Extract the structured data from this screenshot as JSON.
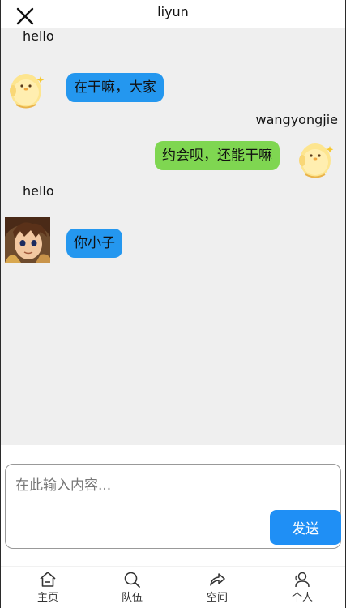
{
  "header": {
    "title": "liyun",
    "close_icon": "close-icon"
  },
  "messages": [
    {
      "sender": "hello",
      "text": "在干嘛，大家",
      "side": "left",
      "avatar": "chick-avatar",
      "bubble_color": "#2497ef"
    },
    {
      "sender": "wangyongjie",
      "text": "约会呗，还能干嘛",
      "side": "right",
      "avatar": "chick-avatar",
      "bubble_color": "#7fd651"
    },
    {
      "sender": "hello",
      "text": "你小子",
      "side": "left",
      "avatar": "boy-avatar",
      "bubble_color": "#2497ef"
    }
  ],
  "composer": {
    "placeholder": "在此输入内容...",
    "send_label": "发送",
    "send_color": "#1f8ff5"
  },
  "tabbar": {
    "items": [
      {
        "label": "主页",
        "icon": "home-icon"
      },
      {
        "label": "队伍",
        "icon": "search-icon"
      },
      {
        "label": "空间",
        "icon": "share-icon"
      },
      {
        "label": "个人",
        "icon": "user-icon"
      }
    ]
  }
}
